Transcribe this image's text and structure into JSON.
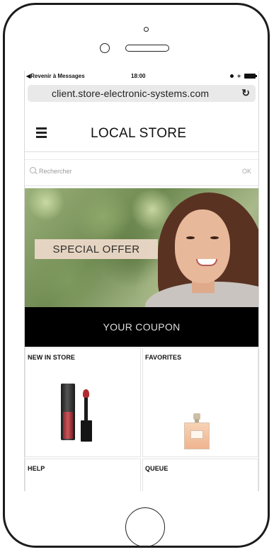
{
  "status_bar": {
    "back_label": "◀Revenir à Messages",
    "time": "18:00"
  },
  "browser": {
    "url": "client.store-electronic-systems.com",
    "reload_icon": "reload-icon"
  },
  "header": {
    "menu_icon": "hamburger-menu-icon",
    "title": "LOCAL STORE"
  },
  "search": {
    "placeholder": "Rechercher",
    "ok_label": "OK",
    "icon": "search-icon"
  },
  "banner": {
    "offer_label": "SPECIAL OFFER"
  },
  "coupon": {
    "label": "YOUR COUPON",
    "background": "#000000"
  },
  "tiles": [
    {
      "label": "NEW IN STORE"
    },
    {
      "label": "FAVORITES"
    },
    {
      "label": "HELP"
    },
    {
      "label": "QUEUE"
    }
  ]
}
